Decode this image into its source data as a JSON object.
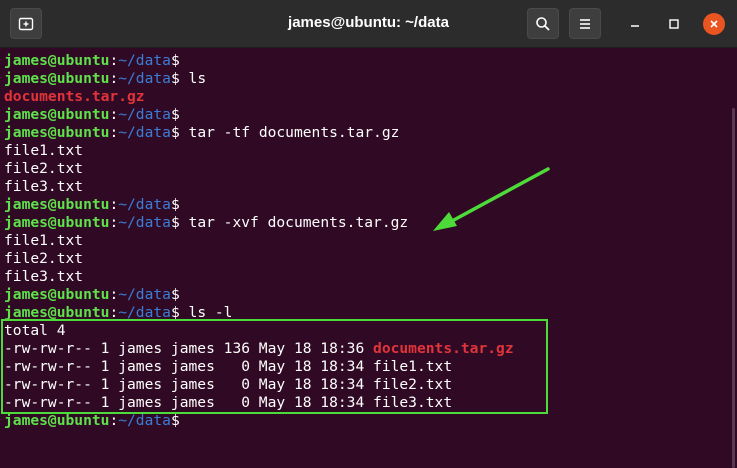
{
  "window": {
    "title": "james@ubuntu: ~/data"
  },
  "colors": {
    "user": "#5ee14b",
    "path": "#3c7cd6",
    "archive": "#e0343a",
    "annotation": "#4ddb3a"
  },
  "icons": {
    "new_tab": "new-tab-icon",
    "search": "search-icon",
    "menu": "hamburger-menu-icon",
    "minimize": "minimize-icon",
    "maximize": "maximize-icon",
    "close": "close-icon"
  },
  "prompt": {
    "user": "james@ubuntu",
    "colon": ":",
    "path": "~/data",
    "symbol": "$"
  },
  "terminal": {
    "cmd_ls": " ls",
    "ls_output": "documents.tar.gz",
    "cmd_list": " tar -tf documents.tar.gz",
    "list_output": [
      "file1.txt",
      "file2.txt",
      "file3.txt"
    ],
    "cmd_extract": " tar -xvf documents.tar.gz",
    "extract_output": [
      "file1.txt",
      "file2.txt",
      "file3.txt"
    ],
    "cmd_ls_l": " ls -l",
    "total": "total 4",
    "ls_l_rows": [
      {
        "meta": "-rw-rw-r-- 1 james james 136 May 18 18:36 ",
        "name": "documents.tar.gz"
      },
      {
        "meta": "-rw-rw-r-- 1 james james   0 May 18 18:34 ",
        "name": "file1.txt"
      },
      {
        "meta": "-rw-rw-r-- 1 james james   0 May 18 18:34 ",
        "name": "file2.txt"
      },
      {
        "meta": "-rw-rw-r-- 1 james james   0 May 18 18:34 ",
        "name": "file3.txt"
      }
    ]
  }
}
